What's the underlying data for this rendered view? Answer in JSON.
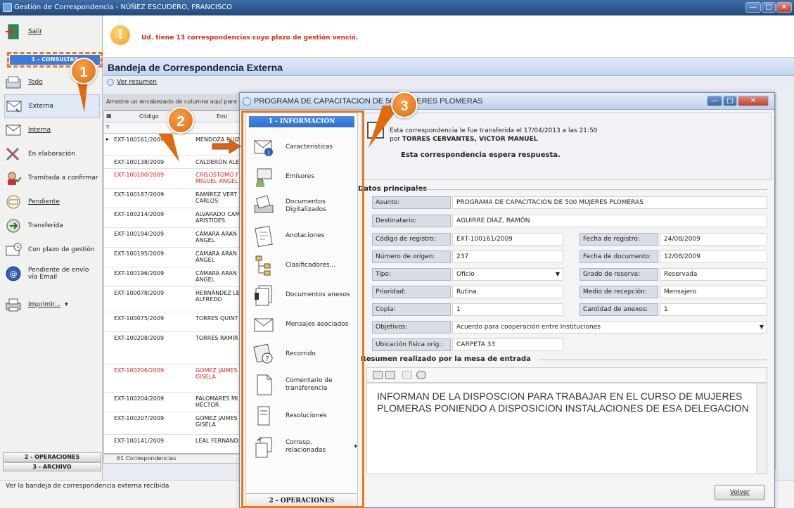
{
  "window": {
    "title": "Gestión de Correspondencia - NÚÑEZ ESCUDERO, FRANCISCO",
    "controls": [
      "—",
      "□",
      "✕"
    ]
  },
  "alert": {
    "text": "Ud. tiene 13 correspondencias cuyo plazo de gestión venció."
  },
  "sidebar": {
    "salir": "Salir",
    "consultas_header": "1 - CONSULTAS",
    "items": [
      {
        "label": "Todo",
        "icon": "tray-icon"
      },
      {
        "label": "Externa",
        "icon": "envelope-in-icon"
      },
      {
        "label": "Interna",
        "icon": "envelope-icon"
      },
      {
        "label": "En elaboración",
        "icon": "tools-icon"
      },
      {
        "label": "Tramitada a confirmar",
        "icon": "check-user-icon"
      },
      {
        "label": "Pendiente",
        "icon": "pending-icon"
      },
      {
        "label": "Transferida",
        "icon": "transfer-icon"
      },
      {
        "label": "Con plazo de gestión",
        "icon": "clock-envelope-icon"
      },
      {
        "label": "Pendiente de envío vía Email",
        "icon": "email-icon"
      },
      {
        "label": "Imprimir...",
        "icon": "printer-icon"
      }
    ],
    "section_operaciones": "2 - OPERACIONES",
    "section_archivo": "3 - ARCHIVO"
  },
  "bandeja": {
    "title": "Bandeja de Correspondencia Externa",
    "ver_resumen": "Ver resumen",
    "group_hint": "Arrastre un encabezado de columna aquí para",
    "columns": [
      "Código",
      "Emi"
    ],
    "rows": [
      {
        "code": "EXT-100161/2009",
        "name": "MENDOZA RUIZ",
        "red": false
      },
      {
        "code": "EXT-100138/2009",
        "name": "CALDERÓN ALE",
        "red": false
      },
      {
        "code": "EXT-100180/2009",
        "name": "CRISOSTOMO F MIGUEL ANGEL",
        "red": true
      },
      {
        "code": "EXT-100187/2009",
        "name": "RAMÍREZ VERT CARLOS",
        "red": false
      },
      {
        "code": "EXT-100214/2009",
        "name": "ALVARADO CAM ARISTIDES",
        "red": false
      },
      {
        "code": "EXT-100194/2009",
        "name": "CÁMARA ARAN ÁNGEL",
        "red": false
      },
      {
        "code": "EXT-100195/2009",
        "name": "CÁMARA ARAN ÁNGEL",
        "red": false
      },
      {
        "code": "EXT-100196/2009",
        "name": "CÁMARA ARAN ÁNGEL",
        "red": false
      },
      {
        "code": "EXT-100078/2009",
        "name": "HERNÁNDEZ LE ALFREDO",
        "red": false
      },
      {
        "code": "EXT-100075/2009",
        "name": "TORRES QUINT",
        "red": false
      },
      {
        "code": "EXT-100208/2009",
        "name": "TORRES RAMÍR",
        "red": false
      },
      {
        "code": "EXT-100206/2009",
        "name": "GÓMEZ JAIMES GISELA",
        "red": true
      },
      {
        "code": "EXT-100204/2009",
        "name": "PALOMARES MI HÉCTOR",
        "red": false
      },
      {
        "code": "EXT-100207/2009",
        "name": "GÓMEZ JAIMES GISELA",
        "red": false
      },
      {
        "code": "EXT-100141/2009",
        "name": "LEAL FERNÁND",
        "red": false
      }
    ],
    "count": "61 Correspondencias"
  },
  "status_bar": "Ver la bandeja de correspondencia externa recibida",
  "dialog": {
    "title": "PROGRAMA DE CAPACITACION DE 500 MUJERES PLOMERAS",
    "nav_header": "1 - INFORMACIÓN",
    "nav_items": [
      {
        "label": "Características",
        "icon": "envelope-info-icon"
      },
      {
        "label": "Emisores",
        "icon": "users-icon"
      },
      {
        "label": "Documentos Digitalizados",
        "icon": "scanner-icon"
      },
      {
        "label": "Anotaciones",
        "icon": "notepad-icon"
      },
      {
        "label": "Clasificadores...",
        "icon": "tree-icon"
      },
      {
        "label": "Documentos anexos",
        "icon": "attachments-icon"
      },
      {
        "label": "Mensajes asociados",
        "icon": "mail-icon"
      },
      {
        "label": "Recorrido",
        "icon": "route-icon"
      },
      {
        "label": "Comentario de transferencia",
        "icon": "document-icon"
      },
      {
        "label": "Resoluciones",
        "icon": "resolution-icon"
      },
      {
        "label": "Corresp. relacionadas",
        "icon": "related-docs-icon"
      }
    ],
    "nav_footer": "2 - OPERACIONES",
    "transfer_line1": "Esta correspondencia le fue transferida el 17/04/2013 a las 21:50",
    "transfer_by_prefix": "por",
    "transfer_by": "TORRES CERVANTES, VICTOR MANUEL",
    "transfer_line3": "Esta correspondencia espera respuesta.",
    "datos_title": "Datos principales",
    "fields": {
      "asunto_label": "Asunto:",
      "asunto": "PROGRAMA DE CAPACITACION DE 500 MUJERES PLOMERAS",
      "destinatario_label": "Destinatario:",
      "destinatario": "AGUIRRE DÍAZ, RAMÓN",
      "codigo_label": "Código de registro:",
      "codigo": "EXT-100161/2009",
      "fecha_registro_label": "Fecha de registro:",
      "fecha_registro": "24/08/2009",
      "numero_origen_label": "Número de origen:",
      "numero_origen": "237",
      "fecha_documento_label": "Fecha de documento:",
      "fecha_documento": "12/08/2009",
      "tipo_label": "Tipo:",
      "tipo": "Oficio",
      "grado_label": "Grado de reserva:",
      "grado": "Reservada",
      "prioridad_label": "Prioridad:",
      "prioridad": "Rutina",
      "medio_label": "Medio de recepción:",
      "medio": "Mensajero",
      "copia_label": "Copia:",
      "copia": "1",
      "anexos_label": "Cantidad de anexos:",
      "anexos": "1",
      "objetivos_label": "Objetivos:",
      "objetivos": "Acuerdo para cooperación entre Instituciones",
      "ubicacion_label": "Ubicación física orig.:",
      "ubicacion": "CARPETA 33"
    },
    "resumen_title": "Resumen realizado por la mesa de entrada",
    "resumen_text": "INFORMAN DE LA DISPOSCION PARA TRABAJAR EN EL CURSO DE MUJERES PLOMERAS PONIENDO A DISPOSICION INSTALACIONES DE ESA DELEGACION",
    "volver": "Volver"
  },
  "callouts": [
    "1",
    "2",
    "3"
  ],
  "colors": {
    "accent": "#e8781e",
    "alert_red": "#d62a1a",
    "nav_blue": "#2f6fd0"
  }
}
